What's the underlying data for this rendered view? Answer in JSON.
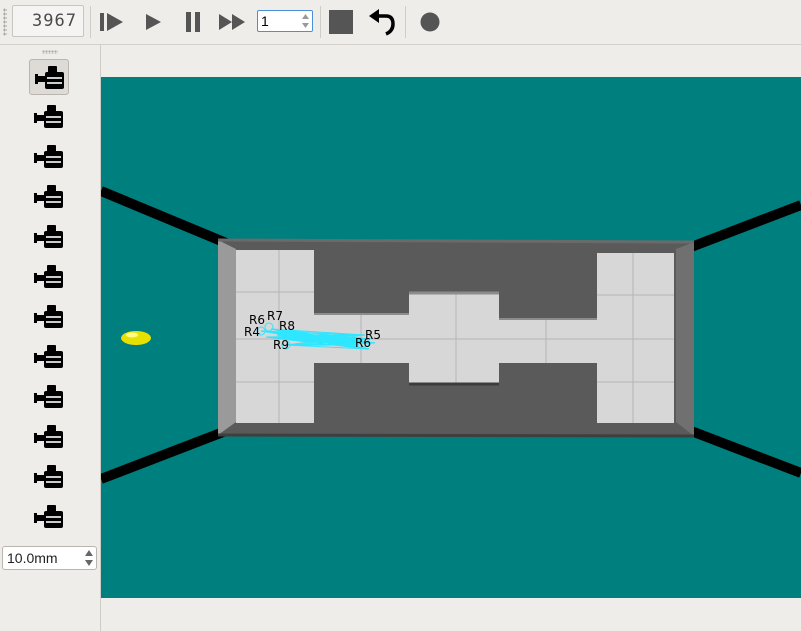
{
  "toolbar": {
    "step_counter": "3967",
    "speed_value": "1",
    "buttons": [
      {
        "name": "step-forward-button",
        "icon": "step-forward-icon"
      },
      {
        "name": "play-button",
        "icon": "play-icon"
      },
      {
        "name": "pause-button",
        "icon": "pause-icon"
      },
      {
        "name": "fast-forward-button",
        "icon": "fast-forward-icon"
      },
      {
        "name": "stop-button",
        "icon": "stop-icon"
      },
      {
        "name": "reset-button",
        "icon": "undo-arrow-icon"
      },
      {
        "name": "record-button",
        "icon": "record-dot-icon"
      }
    ]
  },
  "camera_panel": {
    "camera_count": 12,
    "active_index": 0,
    "icon": "video-camera-icon",
    "grid_size": "10.0mm"
  },
  "scene": {
    "background_color": "#007f7f",
    "robot_labels": [
      "R6",
      "R7",
      "R8",
      "R4",
      "R9",
      "R5",
      "R6"
    ],
    "ray_color": "#2ee6ff",
    "ball_color": "#e8e000"
  }
}
